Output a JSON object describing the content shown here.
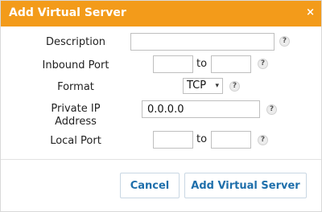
{
  "dialog": {
    "title": "Add Virtual Server",
    "close_glyph": "×"
  },
  "fields": {
    "description": {
      "label": "Description",
      "value": ""
    },
    "inbound_port": {
      "label": "Inbound Port",
      "from_value": "",
      "to_label": "to",
      "to_value": ""
    },
    "format": {
      "label": "Format",
      "selected": "TCP",
      "arrow": "▾"
    },
    "private_ip": {
      "label_line1": "Private IP",
      "label_line2": "Address",
      "value": "0.0.0.0"
    },
    "local_port": {
      "label": "Local Port",
      "from_value": "",
      "to_label": "to",
      "to_value": ""
    }
  },
  "help_glyph": "?",
  "buttons": {
    "cancel": "Cancel",
    "submit": "Add Virtual Server"
  },
  "colors": {
    "title_bar": "#f39b1a",
    "button_text": "#1f6fab"
  }
}
